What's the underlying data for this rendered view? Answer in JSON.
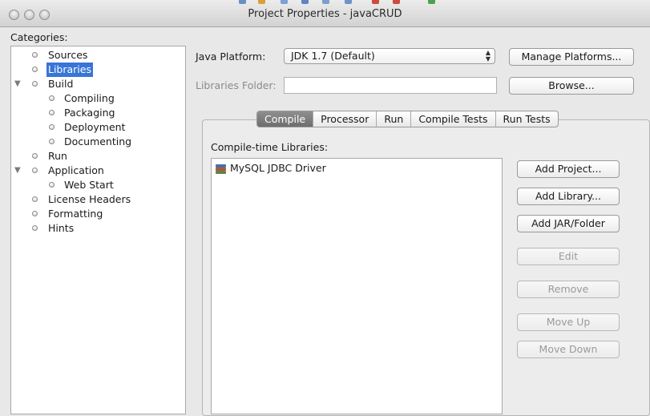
{
  "window": {
    "title": "Project Properties - javaCRUD"
  },
  "categories": {
    "label": "Categories:",
    "items": [
      {
        "label": "Sources"
      },
      {
        "label": "Libraries",
        "selected": true
      },
      {
        "label": "Build",
        "expanded": true
      },
      {
        "label": "Compiling"
      },
      {
        "label": "Packaging"
      },
      {
        "label": "Deployment"
      },
      {
        "label": "Documenting"
      },
      {
        "label": "Run"
      },
      {
        "label": "Application",
        "expanded": true
      },
      {
        "label": "Web Start"
      },
      {
        "label": "License Headers"
      },
      {
        "label": "Formatting"
      },
      {
        "label": "Hints"
      }
    ]
  },
  "platform": {
    "label": "Java Platform:",
    "selected": "JDK 1.7 (Default)",
    "manage_button": "Manage Platforms..."
  },
  "libraries_folder": {
    "label": "Libraries Folder:",
    "value": "",
    "browse_button": "Browse..."
  },
  "tabs": [
    {
      "label": "Compile",
      "active": true
    },
    {
      "label": "Processor"
    },
    {
      "label": "Run"
    },
    {
      "label": "Compile Tests"
    },
    {
      "label": "Run Tests"
    }
  ],
  "compile": {
    "list_label": "Compile-time Libraries:",
    "libraries": [
      "MySQL JDBC Driver"
    ],
    "buttons": {
      "add_project": "Add Project...",
      "add_library": "Add Library...",
      "add_jar": "Add JAR/Folder",
      "edit": "Edit",
      "remove": "Remove",
      "move_up": "Move Up",
      "move_down": "Move Down"
    }
  },
  "colors": {
    "selection": "#3875d7",
    "active_tab": "#7a7a7a",
    "window_bg": "#e8e8e8"
  }
}
